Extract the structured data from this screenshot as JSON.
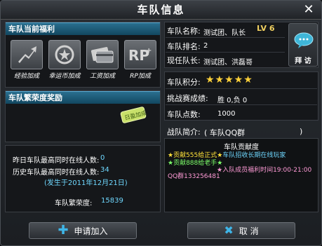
{
  "window": {
    "title": "车队信息",
    "close": "✕"
  },
  "benefits": {
    "header": "车队当前福利",
    "items": [
      {
        "label": "经验加成",
        "icon": "arrow-up-icon"
      },
      {
        "label": "幸运币加成",
        "icon": "coin-icon"
      },
      {
        "label": "工资加成",
        "icon": "card-icon"
      },
      {
        "label": "RP加成",
        "icon": "rp-icon"
      }
    ]
  },
  "prosperity": {
    "header": "车队繁荣度奖励",
    "badge_text": "日盈加成"
  },
  "online": {
    "yesterday_label": "昨日车队最高同时在线人数:",
    "yesterday_value": "0",
    "history_label": "历史车队最高同时在线人数:",
    "history_value": "34",
    "history_date": "(发生于2011年12月21日)",
    "prosperity_label": "车队繁荣度:",
    "prosperity_value": "15839"
  },
  "team": {
    "name_label": "车队名称:",
    "name_value": "测试团、队长",
    "level": "LV 6",
    "rank_label": "车队排名:",
    "rank_value": "2",
    "leader_label": "现任队长:",
    "leader_value": "测试团、洪磊哥",
    "visit_label": "拜 访",
    "points_label": "车队积分:",
    "stars": "★★★★★",
    "record_label": "挑战赛成绩:",
    "record_value": "胜 0,负 0",
    "team_points_label": "车队点数:",
    "team_points_value": "1000",
    "intro_label": "战队简介:",
    "intro_value": "( 车队QQ群",
    "intro_close": ")"
  },
  "intro_box": {
    "title": "车队贡献度",
    "line1_a": "★贡献555给正式★",
    "line1_b": "车队招收长期在线玩家",
    "line2": "★贡献888给老手★",
    "line3": "★入队成员福利时间19:00-21:00",
    "line4": "QQ群133256481"
  },
  "buttons": {
    "join": "申请加入",
    "cancel": "取 消"
  },
  "colors": {
    "accent": "#6fd8ff",
    "header": "#2a6f8f",
    "star": "#ffd23a"
  }
}
